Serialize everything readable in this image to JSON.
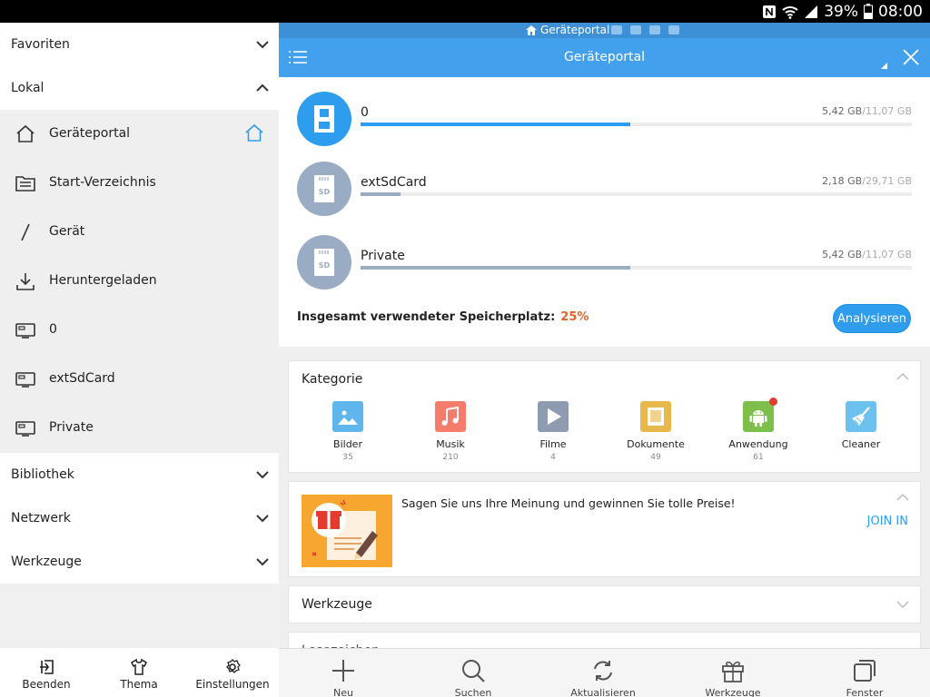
{
  "status": {
    "battery": "39%",
    "time": "08:00"
  },
  "drawer": {
    "sections": [
      {
        "label": "Favoriten"
      },
      {
        "label": "Lokal"
      },
      {
        "label": "Bibliothek"
      },
      {
        "label": "Netzwerk"
      },
      {
        "label": "Werkzeuge"
      }
    ],
    "local_items": [
      {
        "label": "Geräteportal",
        "icon": "home-icon"
      },
      {
        "label": "Start-Verzeichnis",
        "icon": "folder-icon"
      },
      {
        "label": "Gerät",
        "icon": "slash-icon"
      },
      {
        "label": "Heruntergeladen",
        "icon": "download-icon"
      },
      {
        "label": "0",
        "icon": "storage-icon"
      },
      {
        "label": "extSdCard",
        "icon": "sdcard-icon"
      },
      {
        "label": "Private",
        "icon": "storage-icon"
      }
    ],
    "bottom": {
      "exit": "Beenden",
      "theme": "Thema",
      "settings": "Einstellungen"
    }
  },
  "main": {
    "window_tab": "Geräteportal",
    "title": "Geräteportal",
    "storage": [
      {
        "name": "0",
        "used": "5,42 GB",
        "total": "/11,07 GB",
        "fraction": 0.49,
        "color": "#2e9ded"
      },
      {
        "name": "extSdCard",
        "used": "2,18 GB",
        "total": "/29,71 GB",
        "fraction": 0.073,
        "color": "#9aabc4"
      },
      {
        "name": "Private",
        "used": "5,42 GB",
        "total": "/11,07 GB",
        "fraction": 0.49,
        "color": "#9aabc4"
      }
    ],
    "total_label": "Insgesamt verwendeter Speicherplatz:",
    "total_pct": "25%",
    "analyze_label": "Analysieren",
    "category_title": "Kategorie",
    "categories": [
      {
        "name": "Bilder",
        "count": "35",
        "color": "#5fb6ec",
        "icon": "image-icon"
      },
      {
        "name": "Musik",
        "count": "210",
        "color": "#f47c6c",
        "icon": "music-icon"
      },
      {
        "name": "Filme",
        "count": "4",
        "color": "#8e9bb0",
        "icon": "play-icon"
      },
      {
        "name": "Dokumente",
        "count": "49",
        "color": "#e8b94a",
        "icon": "document-icon"
      },
      {
        "name": "Anwendung",
        "count": "61",
        "color": "#7cc04b",
        "icon": "android-icon"
      },
      {
        "name": "Cleaner",
        "count": "",
        "color": "#6dc1ef",
        "icon": "broom-icon"
      }
    ],
    "promo_text": "Sagen Sie uns Ihre Meinung und gewinnen Sie tolle Preise!",
    "promo_join": "JOIN IN",
    "tools_title": "Werkzeuge",
    "more_title": "Lesezeichen"
  },
  "bottom_bar": {
    "new": "Neu",
    "search": "Suchen",
    "refresh": "Aktualisieren",
    "tools": "Werkzeuge",
    "windows": "Fenster"
  }
}
